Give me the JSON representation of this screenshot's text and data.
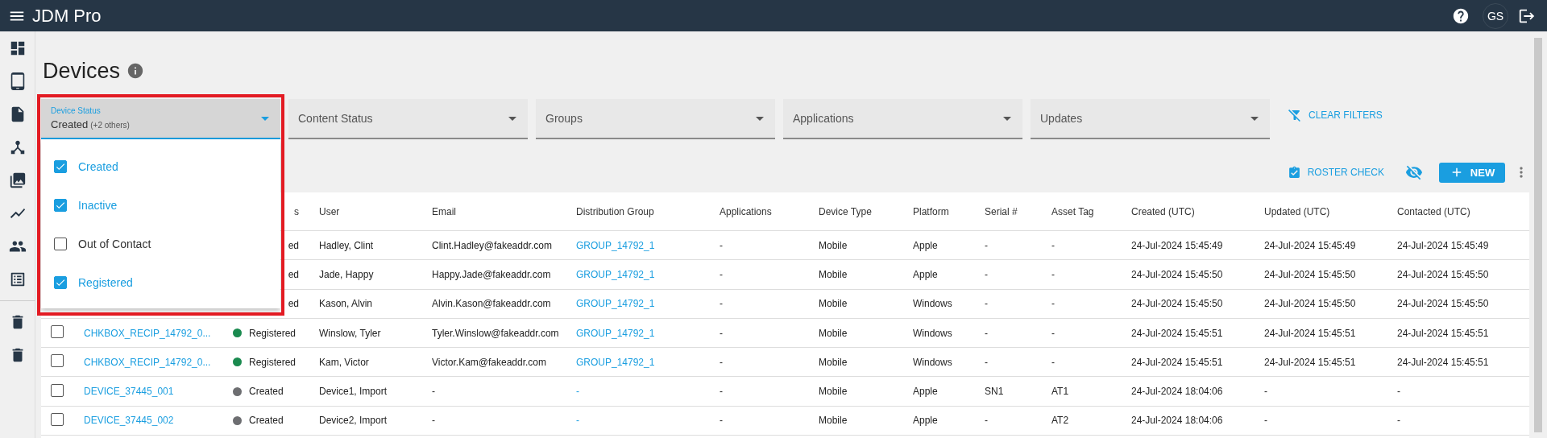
{
  "topbar": {
    "title": "JDM Pro",
    "avatar": "GS"
  },
  "page": {
    "title": "Devices"
  },
  "filters": [
    {
      "label": "Device Status",
      "value": "Created",
      "note": "(+2 others)",
      "expanded": true,
      "highlighted": true,
      "options": [
        {
          "label": "Created",
          "checked": true
        },
        {
          "label": "Inactive",
          "checked": true
        },
        {
          "label": "Out of Contact",
          "checked": false
        },
        {
          "label": "Registered",
          "checked": true
        }
      ]
    },
    {
      "label": "Content Status",
      "expanded": false,
      "highlighted": false
    },
    {
      "label": "Groups",
      "expanded": false,
      "highlighted": false
    },
    {
      "label": "Applications",
      "expanded": false,
      "highlighted": false
    },
    {
      "label": "Updates",
      "expanded": false,
      "highlighted": false
    }
  ],
  "clear_filters": "CLEAR FILTERS",
  "toolbar": {
    "roster_check": "ROSTER CHECK",
    "new": "NEW"
  },
  "table": {
    "columns": [
      {},
      {},
      {
        "label": "s"
      },
      {
        "label": "User"
      },
      {
        "label": "Email"
      },
      {
        "label": "Distribution Group"
      },
      {
        "label": "Applications"
      },
      {
        "label": "Device Type"
      },
      {
        "label": "Platform"
      },
      {
        "label": "Serial #"
      },
      {
        "label": "Asset Tag"
      },
      {
        "label": "Created (UTC)"
      },
      {
        "label": "Updated (UTC)"
      },
      {
        "label": "Contacted (UTC)"
      }
    ],
    "rows": [
      {
        "status": {
          "label": "ed"
        },
        "user": "Hadley, Clint",
        "email": "Clint.Hadley@fakeaddr.com",
        "group": "GROUP_14792_1",
        "applications": "-",
        "device_type": "Mobile",
        "platform": "Apple",
        "serial": "-",
        "asset_tag": "-",
        "created": "24-Jul-2024 15:45:49",
        "updated": "24-Jul-2024 15:45:49",
        "contacted": "24-Jul-2024 15:45:49"
      },
      {
        "status": {
          "label": "ed"
        },
        "user": "Jade, Happy",
        "email": "Happy.Jade@fakeaddr.com",
        "group": "GROUP_14792_1",
        "applications": "-",
        "device_type": "Mobile",
        "platform": "Apple",
        "serial": "-",
        "asset_tag": "-",
        "created": "24-Jul-2024 15:45:50",
        "updated": "24-Jul-2024 15:45:50",
        "contacted": "24-Jul-2024 15:45:50"
      },
      {
        "status": {
          "label": "ed"
        },
        "user": "Kason, Alvin",
        "email": "Alvin.Kason@fakeaddr.com",
        "group": "GROUP_14792_1",
        "applications": "-",
        "device_type": "Mobile",
        "platform": "Windows",
        "serial": "-",
        "asset_tag": "-",
        "created": "24-Jul-2024 15:45:50",
        "updated": "24-Jul-2024 15:45:50",
        "contacted": "24-Jul-2024 15:45:50"
      },
      {
        "checked": false,
        "name": "CHKBOX_RECIP_14792_0...",
        "status": {
          "label": "Registered",
          "color": "#1a8a4f"
        },
        "user": "Winslow, Tyler",
        "email": "Tyler.Winslow@fakeaddr.com",
        "group": "GROUP_14792_1",
        "applications": "-",
        "device_type": "Mobile",
        "platform": "Windows",
        "serial": "-",
        "asset_tag": "-",
        "created": "24-Jul-2024 15:45:51",
        "updated": "24-Jul-2024 15:45:51",
        "contacted": "24-Jul-2024 15:45:51"
      },
      {
        "checked": false,
        "name": "CHKBOX_RECIP_14792_0...",
        "status": {
          "label": "Registered",
          "color": "#1a8a4f"
        },
        "user": "Kam, Victor",
        "email": "Victor.Kam@fakeaddr.com",
        "group": "GROUP_14792_1",
        "applications": "-",
        "device_type": "Mobile",
        "platform": "Windows",
        "serial": "-",
        "asset_tag": "-",
        "created": "24-Jul-2024 15:45:51",
        "updated": "24-Jul-2024 15:45:51",
        "contacted": "24-Jul-2024 15:45:51"
      },
      {
        "checked": false,
        "name": "DEVICE_37445_001",
        "status": {
          "label": "Created",
          "color": "#6d6e71"
        },
        "user": "Device1, Import",
        "email": "-",
        "group": "-",
        "applications": "-",
        "device_type": "Mobile",
        "platform": "Apple",
        "serial": "SN1",
        "asset_tag": "AT1",
        "created": "24-Jul-2024 18:04:06",
        "updated": "-",
        "contacted": "-"
      },
      {
        "checked": false,
        "name": "DEVICE_37445_002",
        "status": {
          "label": "Created",
          "color": "#6d6e71"
        },
        "user": "Device2, Import",
        "email": "-",
        "group": "-",
        "applications": "-",
        "device_type": "Mobile",
        "platform": "Apple",
        "serial": "-",
        "asset_tag": "AT2",
        "created": "24-Jul-2024 18:04:06",
        "updated": "-",
        "contacted": "-"
      }
    ]
  }
}
